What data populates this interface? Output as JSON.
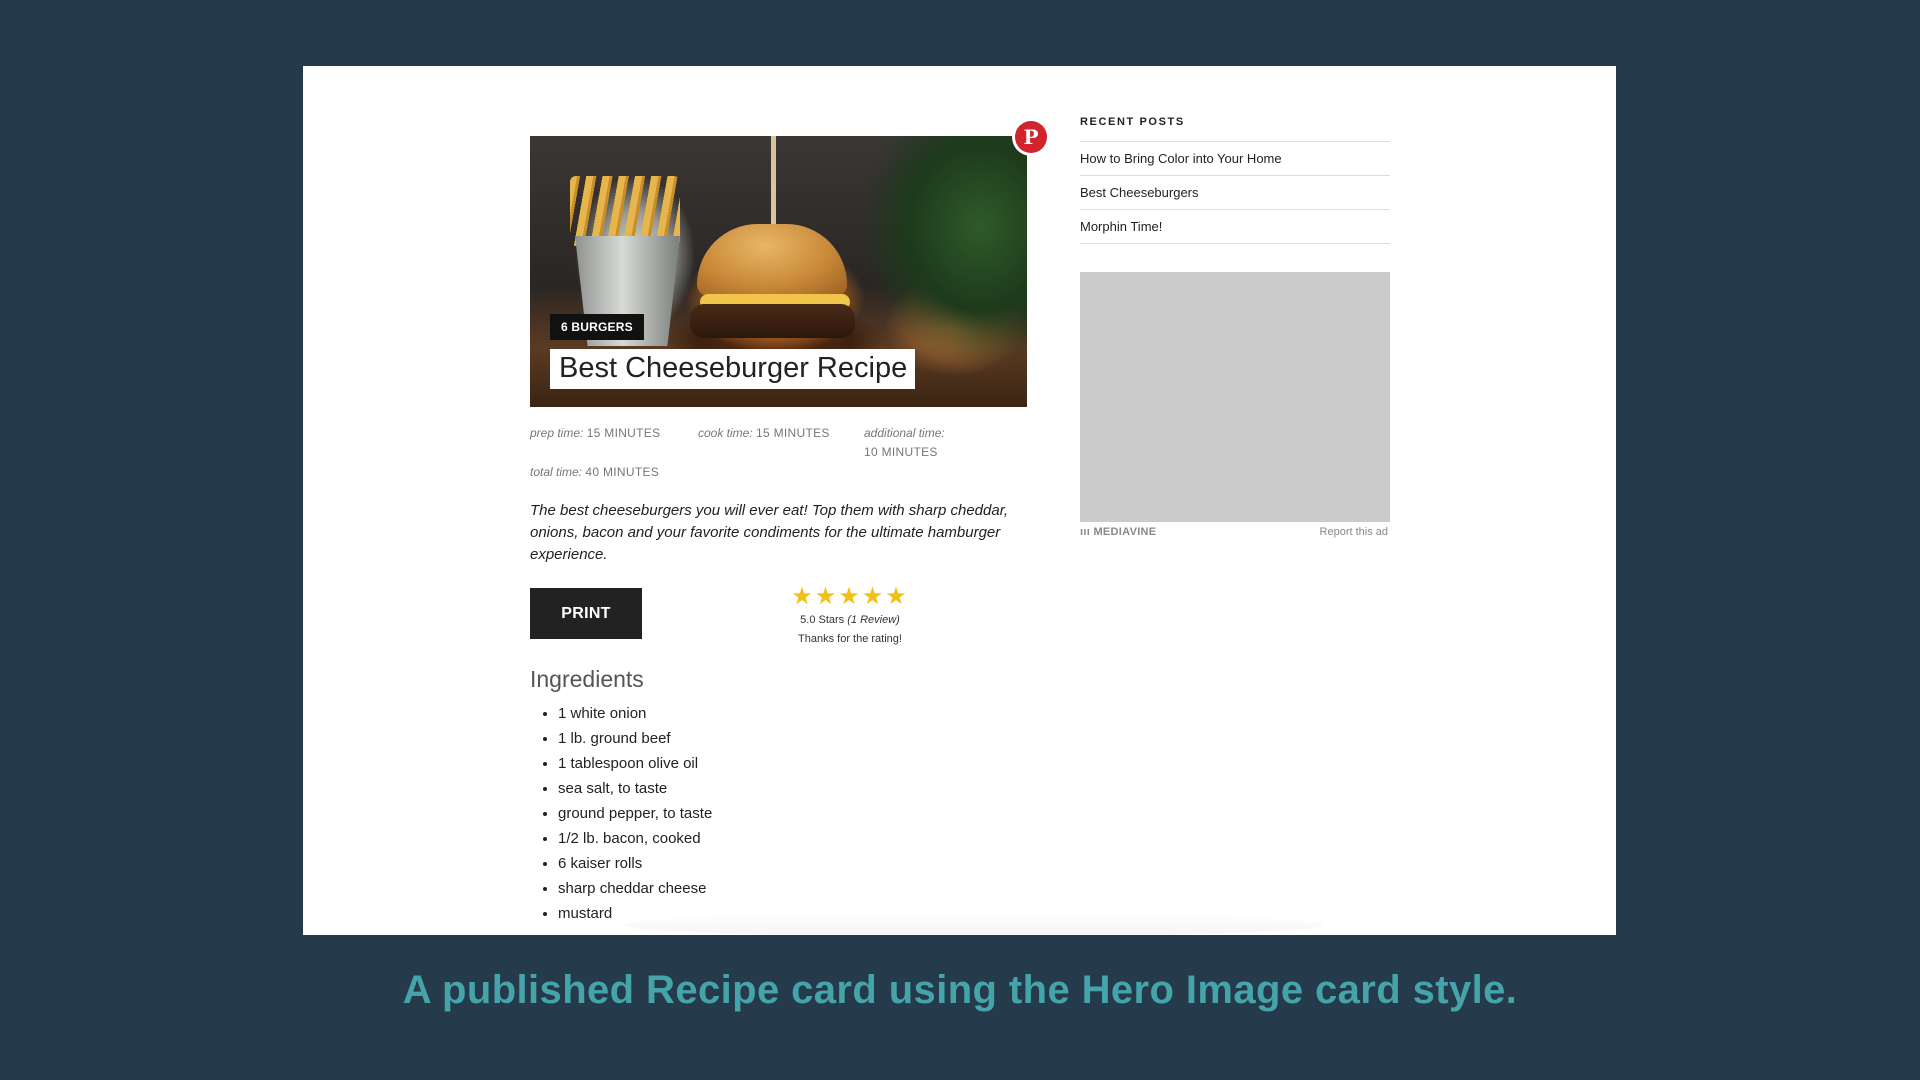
{
  "recipe": {
    "badge": "6 BURGERS",
    "title": "Best Cheeseburger Recipe",
    "pin_icon": "pinterest-icon",
    "prep": {
      "label": "prep time:",
      "value": "15 MINUTES"
    },
    "cook": {
      "label": "cook time:",
      "value": "15 MINUTES"
    },
    "additional": {
      "label": "additional time:",
      "value": "10 MINUTES"
    },
    "total": {
      "label": "total time:",
      "value": "40 MINUTES"
    },
    "summary": "The best cheeseburgers you will ever eat! Top them with sharp cheddar, onions, bacon and your favorite condiments for the ultimate hamburger experience.",
    "print_label": "PRINT",
    "rating": {
      "stars": 5,
      "stars_text": "5.0 Stars",
      "reviews_text": "(1 Review)",
      "thanks": "Thanks for the rating!"
    },
    "ingredients_heading": "Ingredients",
    "ingredients": [
      "1 white onion",
      "1 lb. ground beef",
      "1 tablespoon olive oil",
      "sea salt, to taste",
      "ground pepper, to taste",
      "1/2 lb. bacon, cooked",
      "6 kaiser rolls",
      "sharp cheddar cheese",
      "mustard"
    ]
  },
  "sidebar": {
    "title": "RECENT POSTS",
    "posts": [
      "How to Bring Color into Your Home",
      "Best Cheeseburgers",
      "Morphin Time!"
    ],
    "ad_brand": "MEDIAVINE",
    "ad_report": "Report this ad"
  },
  "caption": "A published Recipe card using the Hero Image card style.",
  "colors": {
    "background": "#253a4b",
    "caption": "#44a4aa",
    "star": "#f2c019",
    "pinterest": "#d1242c"
  }
}
